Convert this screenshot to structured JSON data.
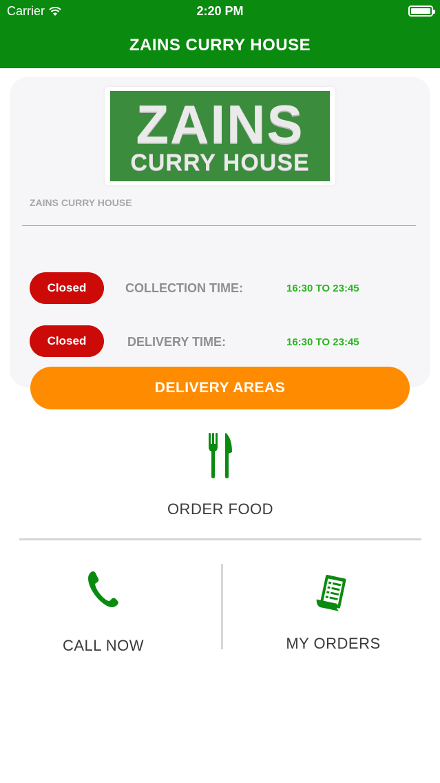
{
  "status_bar": {
    "carrier": "Carrier",
    "time": "2:20 PM",
    "wifi_icon": "wifi-icon",
    "battery_icon": "battery-icon"
  },
  "nav": {
    "title": "ZAINS CURRY HOUSE"
  },
  "logo": {
    "line1": "ZAINS",
    "line2": "CURRY HOUSE"
  },
  "restaurant": {
    "name": "ZAINS CURRY HOUSE"
  },
  "collection": {
    "status": "Closed",
    "label": "COLLECTION TIME:",
    "time": "16:30 TO 23:45"
  },
  "delivery": {
    "status": "Closed",
    "label": "DELIVERY TIME:",
    "time": "16:30 TO 23:45"
  },
  "buttons": {
    "delivery_areas": "DELIVERY AREAS"
  },
  "actions": {
    "order_food": {
      "label": "ORDER FOOD",
      "icon": "fork-knife-icon"
    },
    "call_now": {
      "label": "CALL NOW",
      "icon": "phone-icon"
    },
    "my_orders": {
      "label": "MY ORDERS",
      "icon": "receipt-icon"
    }
  },
  "colors": {
    "brand_green": "#0b8a10",
    "closed_red": "#cc0a08",
    "time_green": "#2bb51f",
    "accent_orange": "#ff8c00"
  }
}
